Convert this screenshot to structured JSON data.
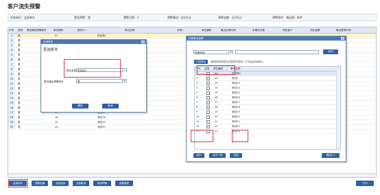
{
  "page": {
    "title": "客户流失预警"
  },
  "filters": [
    {
      "label": "任务单位：全部单位"
    },
    {
      "label": "是否预警：是"
    },
    {
      "label": "预警天数：2"
    },
    {
      "label": "预警情况：近3月以"
    },
    {
      "label": "预警金额：近3月元"
    },
    {
      "label": "预警条件：满足第一条件"
    }
  ],
  "grid": {
    "headers": [
      "行号",
      "选择",
      "是否满足预警条件",
      "单位编码",
      "联系人一",
      "单位全称",
      "手机一",
      "单位编码",
      "最近出库时间",
      "本期天天数",
      "同比客户",
      "同比金额",
      "最近登录时间"
    ],
    "rows": [
      {
        "n": "1",
        "flag": "是",
        "code": "01",
        "name": "供应商1"
      },
      {
        "n": "2",
        "flag": "是",
        "code": "02",
        "name": "测试2"
      },
      {
        "n": "3",
        "flag": "是",
        "code": "03",
        "name": "测试3"
      },
      {
        "n": "4",
        "flag": "是",
        "code": "04",
        "name": "测试4 质量"
      },
      {
        "n": "5",
        "flag": "是",
        "code": "05",
        "name": "测试5"
      },
      {
        "n": "6",
        "flag": "是",
        "code": "06",
        "name": "测试6"
      },
      {
        "n": "7",
        "flag": "是",
        "code": "07",
        "name": "测试7"
      },
      {
        "n": "8",
        "flag": "是",
        "code": "08",
        "name": "测试8"
      },
      {
        "n": "9",
        "flag": "是",
        "code": "09",
        "name": "测试9"
      },
      {
        "n": "10",
        "flag": "是",
        "code": "10",
        "name": "测试10"
      },
      {
        "n": "11",
        "flag": "是",
        "code": "11",
        "name": "测试11"
      },
      {
        "n": "12",
        "flag": "是",
        "code": "12",
        "name": "测试12"
      },
      {
        "n": "13",
        "flag": "是",
        "code": "13",
        "name": "测试13"
      },
      {
        "n": "14",
        "flag": "是",
        "code": "14",
        "name": "测试14"
      },
      {
        "n": "15",
        "flag": "是",
        "code": "15",
        "name": "测试15"
      },
      {
        "n": "16",
        "flag": "是",
        "code": "16",
        "name": "测试16"
      },
      {
        "n": "17",
        "flag": "是",
        "code": "17",
        "name": "测试17"
      },
      {
        "n": "18",
        "flag": "是",
        "code": "18",
        "name": "测试18"
      },
      {
        "n": "19",
        "flag": "是",
        "code": "19",
        "name": "测试19"
      },
      {
        "n": "20",
        "flag": "是",
        "code": "20",
        "name": "测试20"
      }
    ]
  },
  "bottom_buttons": [
    "查询条件",
    "预警设置",
    "全部选择",
    "全部取消",
    "取消预警",
    "查看报表"
  ],
  "right_bottom_button": "打印",
  "query_dialog": {
    "title": "查询条件",
    "section": "查询条件",
    "unit_label": "单位全称",
    "unit_value": "供应商1",
    "cond_label": "是否满足预警条件",
    "cond_value": "是",
    "ok": "确定",
    "cancel": "取消"
  },
  "unit_dialog": {
    "title": "任务单位选择",
    "mode_value": "快速查找",
    "search_button": "查询",
    "tab_label": "已选单位",
    "hint": "请选择查询单位并按条件查询（下次会自动保存）",
    "headers": [
      "行号",
      "选择",
      "单位编码",
      "单位全称"
    ],
    "rows": [
      {
        "n": "1",
        "code": "01",
        "name": "供应商1"
      },
      {
        "n": "2",
        "code": "02",
        "name": "测试2"
      },
      {
        "n": "3",
        "code": "13",
        "name": "测试13"
      },
      {
        "n": "4",
        "code": "14",
        "name": "测试14"
      },
      {
        "n": "5",
        "code": "15",
        "name": "测试15"
      },
      {
        "n": "6",
        "code": "16",
        "name": "测试16"
      },
      {
        "n": "7",
        "code": "17",
        "name": "测试17"
      },
      {
        "n": "8",
        "code": "18",
        "name": "测试18"
      },
      {
        "n": "9",
        "code": "19",
        "name": "测试19"
      },
      {
        "n": "10",
        "code": "20",
        "name": "测试20"
      },
      {
        "n": "11",
        "code": "21",
        "name": "测试21"
      },
      {
        "n": "12",
        "code": "22",
        "name": "测试22"
      },
      {
        "n": "13",
        "code": "23",
        "name": "测试23"
      }
    ],
    "btn_select": "选中",
    "btn_select_one": "选中一条",
    "btn_all": "全部",
    "btn_confirm": "确定(C)"
  }
}
